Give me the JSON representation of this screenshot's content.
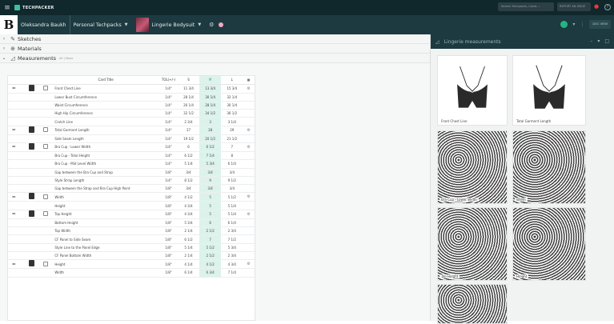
{
  "topbar": {
    "app_name": "TECHPACKER",
    "search_placeholder": "Search Techpacks, Cards ...",
    "report_label": "REPORT AN ISSUE"
  },
  "subbar": {
    "user": "Oleksandra Baukh",
    "workspace": "Personal Techpacks",
    "product": "Lingerie Bodysuit",
    "doc_chip": "DOC VIEW"
  },
  "sections": [
    {
      "label": "Sketches",
      "icon": "pencil-icon"
    },
    {
      "label": "Materials",
      "icon": "materials-icon"
    },
    {
      "label": "Measurements",
      "icon": "ruler-icon",
      "sub": "All | None"
    }
  ],
  "table": {
    "headers": {
      "title": "Card Title",
      "tol": "TOL(+/-)",
      "s": "S",
      "m": "M",
      "l": "L"
    },
    "rows": [
      {
        "group": true,
        "title": "Front Chest Line",
        "tol": "1/4\"",
        "s": "11 3/4",
        "m": "13 3/4",
        "l": "15 3/4"
      },
      {
        "title": "Lower Bust Circumference",
        "tol": "1/4\"",
        "s": "28 1/4",
        "m": "30 1/4",
        "l": "32 1/4"
      },
      {
        "title": "Waist Circumference",
        "tol": "1/4\"",
        "s": "26 1/4",
        "m": "28 1/4",
        "l": "30 1/4"
      },
      {
        "title": "High Hip Circumference",
        "tol": "1/4\"",
        "s": "32 1/2",
        "m": "34 1/2",
        "l": "36 1/2"
      },
      {
        "title": "Crotch Line",
        "tol": "1/4\"",
        "s": "2 3/4",
        "m": "3",
        "l": "3 1/4"
      },
      {
        "group": true,
        "title": "Total Garment Length",
        "tol": "1/4\"",
        "s": "27",
        "m": "28",
        "l": "29"
      },
      {
        "title": "Side Seam Length",
        "tol": "1/4\"",
        "s": "19 1/2",
        "m": "20 1/2",
        "l": "21 1/2"
      },
      {
        "group": true,
        "title": "Bra Cup - Lower Width",
        "tol": "1/4\"",
        "s": "6",
        "m": "6 1/2",
        "l": "7"
      },
      {
        "title": "Bra Cup - Total Height",
        "tol": "1/4\"",
        "s": "6 1/2",
        "m": "7 1/4",
        "l": "8"
      },
      {
        "title": "Bra Cup - Mid Level Width",
        "tol": "1/4\"",
        "s": "5 1/4",
        "m": "5 3/4",
        "l": "6 1/4"
      },
      {
        "title": "Gap between the Bra Cup and Strap",
        "tol": "1/8\"",
        "s": "3/4",
        "m": "3/4",
        "l": "3/4"
      },
      {
        "title": "Style Strap Length",
        "tol": "1/4\"",
        "s": "8 1/2",
        "m": "9",
        "l": "9 1/2"
      },
      {
        "title": "Gap between the Strap and Bra Cup High Point",
        "tol": "1/8\"",
        "s": "3/4",
        "m": "3/4",
        "l": "3/4"
      },
      {
        "group": true,
        "title": "Width",
        "tol": "1/8\"",
        "s": "4 1/2",
        "m": "5",
        "l": "5 1/2"
      },
      {
        "title": "Height",
        "tol": "1/8\"",
        "s": "4 3/4",
        "m": "5",
        "l": "5 1/4"
      },
      {
        "group": true,
        "title": "Top Height",
        "tol": "1/8\"",
        "s": "4 3/4",
        "m": "5",
        "l": "5 1/4"
      },
      {
        "title": "Bottom Height",
        "tol": "1/8\"",
        "s": "5 3/4",
        "m": "6",
        "l": "6 1/4"
      },
      {
        "title": "Top Width",
        "tol": "1/8\"",
        "s": "2 1/4",
        "m": "2 1/2",
        "l": "2 3/4"
      },
      {
        "title": "CF Panel to Side Seam",
        "tol": "1/8\"",
        "s": "6 1/2",
        "m": "7",
        "l": "7 1/2"
      },
      {
        "title": "Style Line to the Panel Edge",
        "tol": "1/8\"",
        "s": "5 1/4",
        "m": "5 1/2",
        "l": "5 3/4"
      },
      {
        "title": "CF Panel Bottom Width",
        "tol": "1/8\"",
        "s": "2 1/4",
        "m": "2 1/2",
        "l": "2 3/4"
      },
      {
        "group": true,
        "title": "Height",
        "tol": "1/8\"",
        "s": "4 1/4",
        "m": "4 1/2",
        "l": "4 3/4"
      },
      {
        "title": "Width",
        "tol": "1/8\"",
        "s": "6 1/4",
        "m": "6 3/4",
        "l": "7 1/4"
      }
    ]
  },
  "panel": {
    "title": "Lingerie measurements",
    "cards": [
      {
        "label": "Front Chest Line"
      },
      {
        "label": "Total Garment Length"
      },
      {
        "label": "Bra Cup - Lower Width"
      },
      {
        "label": "Width"
      },
      {
        "label": "Top Height"
      },
      {
        "label": "Height"
      }
    ]
  },
  "colors": {
    "dark": "#10272c",
    "accent": "#23b583",
    "highlight": "#dcf3ec"
  }
}
